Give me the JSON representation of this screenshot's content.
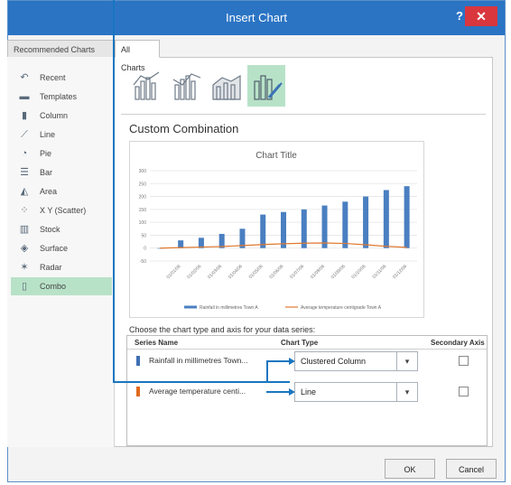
{
  "dialog": {
    "title": "Insert Chart",
    "help_label": "?",
    "close_label": "✕"
  },
  "tabs": [
    {
      "label": "Recommended Charts"
    },
    {
      "label": "All Charts"
    }
  ],
  "sidebar": {
    "items": [
      {
        "label": "Recent",
        "icon": "recent-icon",
        "glyph": "↶"
      },
      {
        "label": "Templates",
        "icon": "folder-icon",
        "glyph": "▬"
      },
      {
        "label": "Column",
        "icon": "column-chart-icon",
        "glyph": "▮"
      },
      {
        "label": "Line",
        "icon": "line-chart-icon",
        "glyph": "⟋"
      },
      {
        "label": "Pie",
        "icon": "pie-chart-icon",
        "glyph": "◔"
      },
      {
        "label": "Bar",
        "icon": "bar-chart-icon",
        "glyph": "☰"
      },
      {
        "label": "Area",
        "icon": "area-chart-icon",
        "glyph": "◭"
      },
      {
        "label": "X Y (Scatter)",
        "icon": "scatter-chart-icon",
        "glyph": "⁘"
      },
      {
        "label": "Stock",
        "icon": "stock-chart-icon",
        "glyph": "▥"
      },
      {
        "label": "Surface",
        "icon": "surface-chart-icon",
        "glyph": "◈"
      },
      {
        "label": "Radar",
        "icon": "radar-chart-icon",
        "glyph": "✶"
      },
      {
        "label": "Combo",
        "icon": "combo-chart-icon",
        "glyph": "▯",
        "selected": true
      }
    ]
  },
  "subtypes": [
    {
      "icon": "combo-clustered-column-line-icon"
    },
    {
      "icon": "combo-column-line-secondary-icon"
    },
    {
      "icon": "combo-stacked-area-column-icon"
    },
    {
      "icon": "custom-combination-icon",
      "selected": true
    }
  ],
  "section_title": "Custom Combination",
  "chart_data": {
    "type": "bar",
    "title": "Chart Title",
    "categories": [
      "01/01/06",
      "01/02/06",
      "01/03/06",
      "01/04/06",
      "01/05/06",
      "01/06/06",
      "01/07/06",
      "01/08/06",
      "01/09/06",
      "01/10/06",
      "01/11/06",
      "01/12/06"
    ],
    "series": [
      {
        "name": "Rainfall in millimetres Town A",
        "type": "column",
        "color": "#4a7fc1",
        "values": [
          0,
          30,
          40,
          55,
          75,
          130,
          140,
          150,
          165,
          180,
          200,
          225,
          240
        ]
      },
      {
        "name": "Average temperature centigrade Town A",
        "type": "line",
        "color": "#e0782f",
        "values": [
          0,
          2,
          4,
          6,
          10,
          14,
          17,
          19,
          20,
          18,
          13,
          7,
          3
        ]
      }
    ],
    "y_ticks": [
      "300",
      "250",
      "200",
      "150",
      "100",
      "50",
      "0",
      "-50"
    ],
    "ylim": [
      -50,
      300
    ],
    "legend_position": "bottom"
  },
  "instruction": "Choose the chart type and axis for your data series:",
  "series_table": {
    "headers": {
      "name": "Series Name",
      "type": "Chart Type",
      "axis": "Secondary Axis"
    },
    "rows": [
      {
        "name": "Rainfall in millimetres Town...",
        "color": "#3f6fb5",
        "chart_type": "Clustered Column",
        "secondary": false
      },
      {
        "name": "Average temperature centi...",
        "color": "#e06a1f",
        "chart_type": "Line",
        "secondary": false
      }
    ]
  },
  "buttons": {
    "ok": "OK",
    "cancel": "Cancel"
  },
  "colors": {
    "accent": "#2b74c4",
    "selection": "#b8e2c8",
    "callout": "#1976bf",
    "close": "#d9363e"
  }
}
